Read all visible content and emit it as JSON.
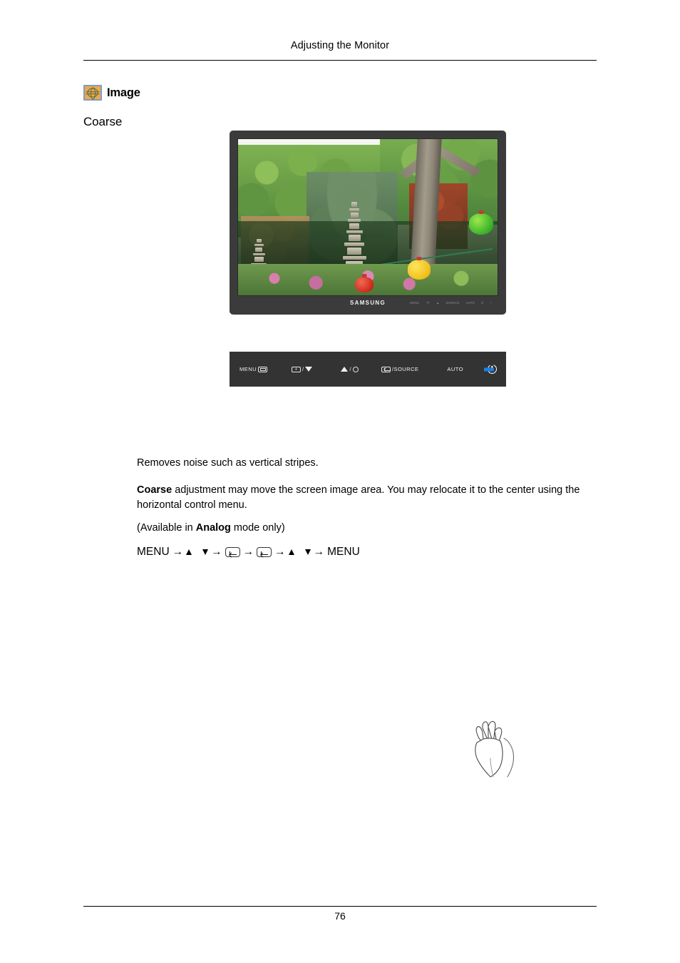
{
  "header": {
    "title": "Adjusting the Monitor"
  },
  "section": {
    "icon": "image-globe-icon",
    "title": "Image",
    "subtitle": "Coarse"
  },
  "monitor": {
    "brand": "SAMSUNG",
    "screen_photo_alt": "Korean temple garden with stone pagodas, green trees, flowering shrubs and paper lanterns",
    "bezel_buttons": [
      "MENU",
      "-/T",
      "A",
      "SOURCE",
      "AUTO",
      "POWER",
      "LED"
    ]
  },
  "control_panel": {
    "buttons": [
      {
        "name": "menu-button",
        "label": "MENU",
        "icon": "window-icon"
      },
      {
        "name": "minus-down-button",
        "label": "/",
        "icon_left": "plus-box-icon",
        "icon_right": "triangle-down-icon"
      },
      {
        "name": "up-brightness-button",
        "label": "/",
        "icon_left": "triangle-up-icon",
        "icon_right": "brightness-sun-icon"
      },
      {
        "name": "enter-source-button",
        "label": "/SOURCE",
        "icon": "enter-key-icon"
      },
      {
        "name": "auto-button",
        "label": "AUTO",
        "icon": ""
      },
      {
        "name": "power-button",
        "label": "",
        "icon": "power-icon"
      }
    ],
    "led_color": "#1a7fe8",
    "strip_color": "#333333",
    "pointer": "hand-pointing-icon"
  },
  "body": {
    "paragraph1": "Removes noise such as vertical stripes.",
    "paragraph2_bold": "Coarse",
    "paragraph2_rest": " adjustment may move the screen image area. You may relocate it to the center using the horizontal control menu.",
    "paragraph3_pre": "(Available in ",
    "paragraph3_bold": "Analog",
    "paragraph3_post": " mode only)"
  },
  "nav_sequence": {
    "start": "MENU",
    "end": "MENU",
    "arrow": "→",
    "steps": [
      "MENU",
      "▲",
      "▼",
      "↵",
      "↵",
      "▲",
      "▼",
      "MENU"
    ]
  },
  "footer": {
    "page_number": "76"
  }
}
